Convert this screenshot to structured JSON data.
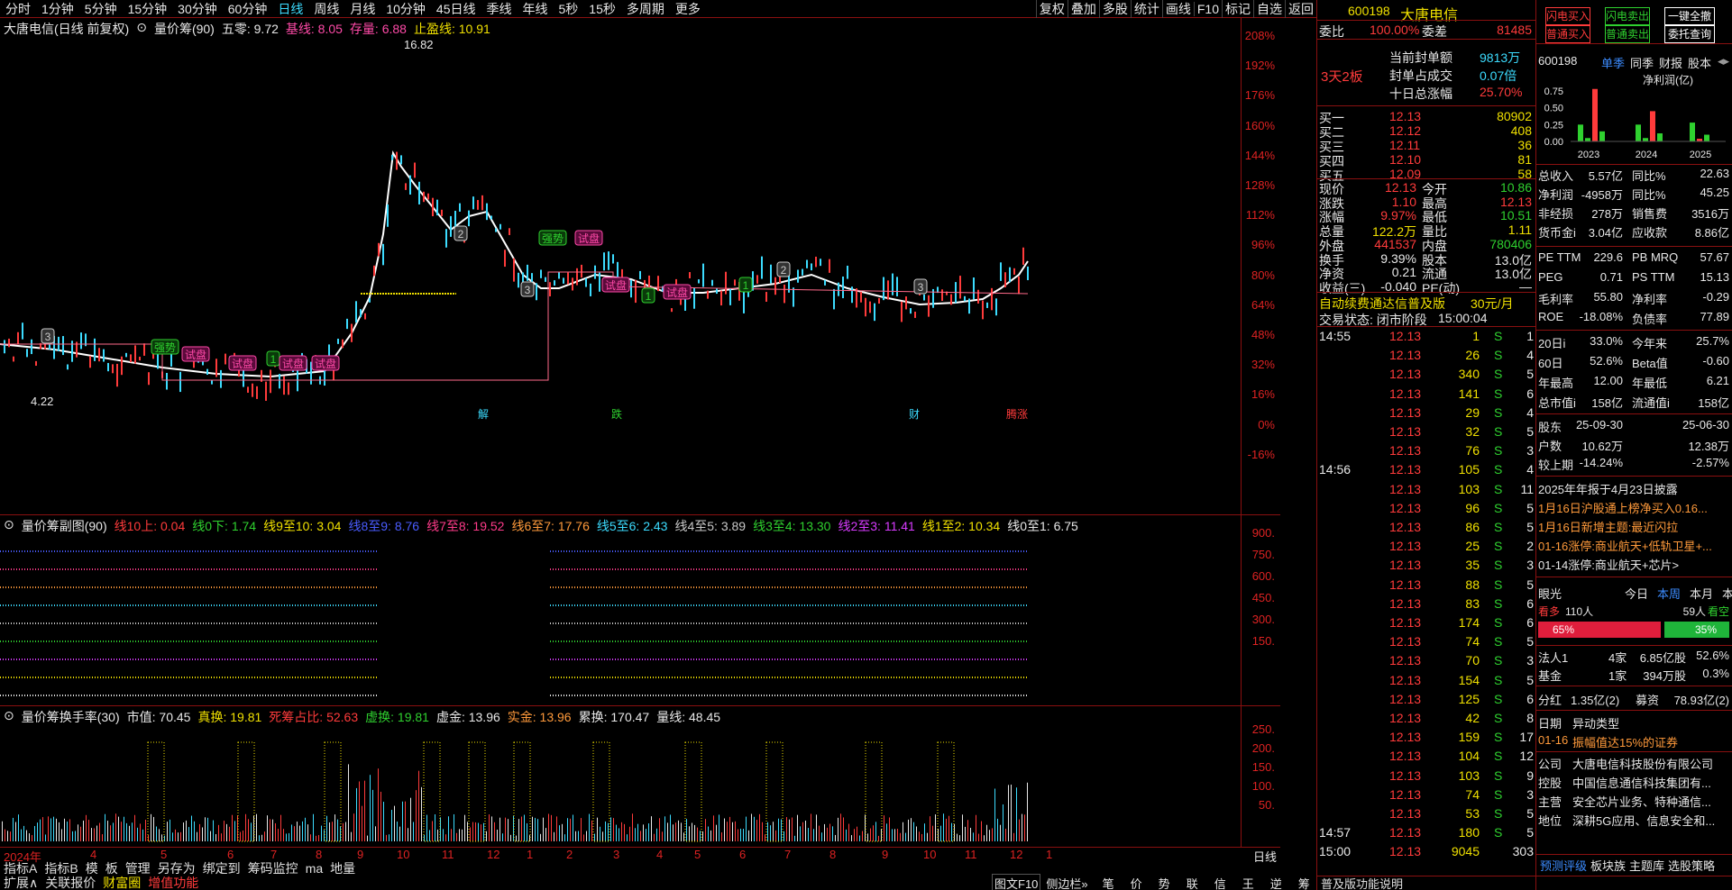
{
  "toolbar": {
    "periods": [
      "分时",
      "1分钟",
      "5分钟",
      "15分钟",
      "30分钟",
      "60分钟",
      "日线",
      "周线",
      "月线",
      "10分钟",
      "45日线",
      "季线",
      "年线",
      "5秒",
      "15秒",
      "多周期",
      "更多"
    ],
    "active_period": "日线",
    "tools": [
      "复权",
      "叠加",
      "多股",
      "统计",
      "画线",
      "F10",
      "标记",
      "自选",
      "返回"
    ]
  },
  "main_chart": {
    "title_parts": [
      {
        "text": "大唐电信(日线 前复权)",
        "color": "#e8e8e8"
      },
      {
        "text": "⊙",
        "color": "#e8e8e8"
      },
      {
        "text": "量价筹(90)",
        "color": "#e8e8e8"
      },
      {
        "text": "五零: 9.72",
        "color": "#e8e8e8"
      },
      {
        "text": "基线: 8.05",
        "color": "#ff4aa8"
      },
      {
        "text": "存量: 6.88",
        "color": "#ff4aa8"
      },
      {
        "text": "止盈线: 10.91",
        "color": "#f0e000"
      }
    ],
    "y_ticks": [
      "208%",
      "192%",
      "176%",
      "160%",
      "144%",
      "128%",
      "112%",
      "96%",
      "80%",
      "64%",
      "48%",
      "32%",
      "16%",
      "0%",
      "-16%"
    ],
    "high_label": "16.82",
    "low_label": "4.22",
    "tags": [
      {
        "text": "强势",
        "type": "green"
      },
      {
        "text": "试盘",
        "type": "pink"
      },
      {
        "text": "试盘",
        "type": "pink"
      },
      {
        "text": "1",
        "type": "green"
      },
      {
        "text": "试盘",
        "type": "pink"
      },
      {
        "text": "试盘",
        "type": "pink"
      },
      {
        "text": "2",
        "type": "gray"
      },
      {
        "text": "3",
        "type": "gray"
      },
      {
        "text": "强势",
        "type": "green"
      },
      {
        "text": "试盘",
        "type": "pink"
      },
      {
        "text": "试盘",
        "type": "pink"
      },
      {
        "text": "1",
        "type": "green"
      },
      {
        "text": "试盘",
        "type": "pink"
      },
      {
        "text": "1",
        "type": "green"
      },
      {
        "text": "2",
        "type": "gray"
      },
      {
        "text": "3",
        "type": "gray"
      },
      {
        "text": "3",
        "type": "gray"
      }
    ],
    "markers": [
      "解",
      "跌",
      "财",
      "腾涨"
    ]
  },
  "sub_chart1": {
    "title_parts": [
      {
        "text": "⊙",
        "color": "#e8e8e8"
      },
      {
        "text": "量价筹副图(90)",
        "color": "#e8e8e8"
      },
      {
        "text": "线10上: 0.04",
        "color": "#ff3b3b"
      },
      {
        "text": "线0下: 1.74",
        "color": "#2fd12f"
      },
      {
        "text": "线9至10: 3.04",
        "color": "#f0e000"
      },
      {
        "text": "线8至9: 8.76",
        "color": "#4a5cff"
      },
      {
        "text": "线7至8: 19.52",
        "color": "#ff3b8a"
      },
      {
        "text": "线6至7: 17.76",
        "color": "#ff9a3b"
      },
      {
        "text": "线5至6: 2.43",
        "color": "#3cdcff"
      },
      {
        "text": "线4至5: 3.89",
        "color": "#c8c8c8"
      },
      {
        "text": "线3至4: 13.30",
        "color": "#2fd12f"
      },
      {
        "text": "线2至3: 11.41",
        "color": "#d83bff"
      },
      {
        "text": "线1至2: 10.34",
        "color": "#f0e000"
      },
      {
        "text": "线0至1: 6.75",
        "color": "#e8e8e8"
      }
    ],
    "y_ticks": [
      "900.",
      "750.",
      "600.",
      "450.",
      "300.",
      "150."
    ]
  },
  "sub_chart2": {
    "title_parts": [
      {
        "text": "⊙",
        "color": "#e8e8e8"
      },
      {
        "text": "量价筹换手率(30)",
        "color": "#e8e8e8"
      },
      {
        "text": "市值: 70.45",
        "color": "#e8e8e8"
      },
      {
        "text": "真换: 19.81",
        "color": "#f0e000"
      },
      {
        "text": "死筹占比: 52.63",
        "color": "#ff3b3b"
      },
      {
        "text": "虚换: 19.81",
        "color": "#2fd12f"
      },
      {
        "text": "虚金: 13.96",
        "color": "#e8e8e8"
      },
      {
        "text": "实金: 13.96",
        "color": "#ff9a3b"
      },
      {
        "text": "累换: 170.47",
        "color": "#e8e8e8"
      },
      {
        "text": "量线: 48.45",
        "color": "#e8e8e8"
      }
    ],
    "y_ticks": [
      "250.",
      "200.",
      "150.",
      "100.",
      "50."
    ]
  },
  "dates": [
    "2024年",
    "4",
    "5",
    "6",
    "7",
    "8",
    "9",
    "10",
    "11",
    "12",
    "1",
    "2",
    "3",
    "4",
    "5",
    "6",
    "7",
    "8",
    "9",
    "10",
    "11",
    "12",
    "1"
  ],
  "date_axis_right": "日线",
  "bottom_tabs1": [
    "指标A",
    "指标B",
    "模",
    "板",
    "管理",
    "另存为",
    "绑定到",
    "筹码监控",
    "ma",
    "地量"
  ],
  "bottom_tabs2": [
    "扩展∧",
    "关联报价",
    "财富圈",
    "增值功能"
  ],
  "status_bar": {
    "text": "普及版功能说明",
    "tab1": "图文F10",
    "tab2": "侧边栏»",
    "icons": [
      "笔",
      "价",
      "势",
      "联",
      "信",
      "王",
      "逆",
      "筹"
    ]
  },
  "quote": {
    "code": "600198",
    "name": "大唐电信",
    "weibi_label": "委比",
    "weibi": "100.00%",
    "weicha_label": "委差",
    "weicha": "81485",
    "board": "3天2板",
    "seal_amount_label": "当前封单额",
    "seal_amount": "9813万",
    "seal_ratio_label": "封单占成交",
    "seal_ratio": "0.07倍",
    "ten_day_label": "十日总涨幅",
    "ten_day": "25.70%",
    "bids": [
      {
        "label": "买一",
        "price": "12.13",
        "vol": "80902"
      },
      {
        "label": "买二",
        "price": "12.12",
        "vol": "408"
      },
      {
        "label": "买三",
        "price": "12.11",
        "vol": "36"
      },
      {
        "label": "买四",
        "price": "12.10",
        "vol": "81"
      },
      {
        "label": "买五",
        "price": "12.09",
        "vol": "58"
      }
    ],
    "stats": [
      {
        "l1": "现价",
        "v1": "12.13",
        "l2": "今开",
        "v2": "10.86",
        "c1": "red",
        "c2": "green"
      },
      {
        "l1": "涨跌",
        "v1": "1.10",
        "l2": "最高",
        "v2": "12.13",
        "c1": "red",
        "c2": "red"
      },
      {
        "l1": "涨幅",
        "v1": "9.97%",
        "l2": "最低",
        "v2": "10.51",
        "c1": "red",
        "c2": "green"
      },
      {
        "l1": "总量",
        "v1": "122.2万",
        "l2": "量比",
        "v2": "1.11",
        "c1": "yellow",
        "c2": "yellow"
      },
      {
        "l1": "外盘",
        "v1": "441537",
        "l2": "内盘",
        "v2": "780406",
        "c1": "red",
        "c2": "green"
      },
      {
        "l1": "换手",
        "v1": "9.39%",
        "l2": "股本",
        "v2": "13.0亿",
        "c1": "white",
        "c2": "white"
      },
      {
        "l1": "净资",
        "v1": "0.21",
        "l2": "流通",
        "v2": "13.0亿",
        "c1": "white",
        "c2": "white"
      },
      {
        "l1": "收益(三)",
        "v1": "-0.040",
        "l2": "PE(动)",
        "v2": "—",
        "c1": "white",
        "c2": "white"
      }
    ],
    "promo": "自动续费通达信普及版",
    "promo_price": "30元/月",
    "trade_state": "交易状态: 闭市阶段",
    "trade_time": "15:00:04",
    "ticks": [
      {
        "time": "14:55",
        "price": "12.13",
        "vol": "1",
        "bs": "S",
        "n": "1"
      },
      {
        "time": "",
        "price": "12.13",
        "vol": "26",
        "bs": "S",
        "n": "4"
      },
      {
        "time": "",
        "price": "12.13",
        "vol": "340",
        "bs": "S",
        "n": "5"
      },
      {
        "time": "",
        "price": "12.13",
        "vol": "141",
        "bs": "S",
        "n": "6"
      },
      {
        "time": "",
        "price": "12.13",
        "vol": "29",
        "bs": "S",
        "n": "4"
      },
      {
        "time": "",
        "price": "12.13",
        "vol": "32",
        "bs": "S",
        "n": "5"
      },
      {
        "time": "",
        "price": "12.13",
        "vol": "76",
        "bs": "S",
        "n": "3"
      },
      {
        "time": "14:56",
        "price": "12.13",
        "vol": "105",
        "bs": "S",
        "n": "4"
      },
      {
        "time": "",
        "price": "12.13",
        "vol": "103",
        "bs": "S",
        "n": "11"
      },
      {
        "time": "",
        "price": "12.13",
        "vol": "96",
        "bs": "S",
        "n": "5"
      },
      {
        "time": "",
        "price": "12.13",
        "vol": "86",
        "bs": "S",
        "n": "5"
      },
      {
        "time": "",
        "price": "12.13",
        "vol": "25",
        "bs": "S",
        "n": "2"
      },
      {
        "time": "",
        "price": "12.13",
        "vol": "35",
        "bs": "S",
        "n": "3"
      },
      {
        "time": "",
        "price": "12.13",
        "vol": "88",
        "bs": "S",
        "n": "5"
      },
      {
        "time": "",
        "price": "12.13",
        "vol": "83",
        "bs": "S",
        "n": "6"
      },
      {
        "time": "",
        "price": "12.13",
        "vol": "174",
        "bs": "S",
        "n": "6"
      },
      {
        "time": "",
        "price": "12.13",
        "vol": "74",
        "bs": "S",
        "n": "5"
      },
      {
        "time": "",
        "price": "12.13",
        "vol": "70",
        "bs": "S",
        "n": "3"
      },
      {
        "time": "",
        "price": "12.13",
        "vol": "154",
        "bs": "S",
        "n": "5"
      },
      {
        "time": "",
        "price": "12.13",
        "vol": "125",
        "bs": "S",
        "n": "6"
      },
      {
        "time": "",
        "price": "12.13",
        "vol": "42",
        "bs": "S",
        "n": "8"
      },
      {
        "time": "",
        "price": "12.13",
        "vol": "159",
        "bs": "S",
        "n": "17"
      },
      {
        "time": "",
        "price": "12.13",
        "vol": "104",
        "bs": "S",
        "n": "12"
      },
      {
        "time": "",
        "price": "12.13",
        "vol": "103",
        "bs": "S",
        "n": "9"
      },
      {
        "time": "",
        "price": "12.13",
        "vol": "74",
        "bs": "S",
        "n": "3"
      },
      {
        "time": "",
        "price": "12.13",
        "vol": "53",
        "bs": "S",
        "n": "5"
      },
      {
        "time": "14:57",
        "price": "12.13",
        "vol": "180",
        "bs": "S",
        "n": "5"
      },
      {
        "time": "15:00",
        "price": "12.13",
        "vol": "9045",
        "bs": "",
        "n": "303"
      }
    ]
  },
  "f10": {
    "buttons": [
      {
        "text": "闪电买入",
        "type": "red"
      },
      {
        "text": "闪电卖出",
        "type": "green"
      },
      {
        "text": "一键全撤",
        "type": "white"
      },
      {
        "text": "普通买入",
        "type": "red"
      },
      {
        "text": "普通卖出",
        "type": "green"
      },
      {
        "text": "委托查询",
        "type": "white"
      }
    ],
    "code": "600198",
    "tabs": [
      "单季",
      "同季",
      "财报",
      "股本"
    ],
    "active_tab": "单季",
    "profit_label": "净利润(亿)",
    "chart_data": {
      "type": "bar",
      "categories": [
        "2023",
        "2024",
        "2025"
      ],
      "y_ticks": [
        "0.75",
        "0.50",
        "0.25",
        "0.00"
      ],
      "ylim": [
        0,
        0.75
      ],
      "series": [
        {
          "group": "2023",
          "values": [
            0.25,
            0.05,
            0.78,
            0.15
          ],
          "colors": [
            "#2fd12f",
            "#2fd12f",
            "#ff3b3b",
            "#2fd12f"
          ]
        },
        {
          "group": "2024",
          "values": [
            0.25,
            0.05,
            0.45,
            0.12
          ],
          "colors": [
            "#2fd12f",
            "#2fd12f",
            "#ff3b3b",
            "#2fd12f"
          ]
        },
        {
          "group": "2025",
          "values": [
            0.28,
            0.04,
            0.1
          ],
          "colors": [
            "#2fd12f",
            "#ff3b3b",
            "#2fd12f"
          ]
        }
      ]
    },
    "fin": [
      {
        "l1": "总收入",
        "v1": "5.57亿",
        "l2": "同比%",
        "v2": "22.63",
        "c2": "white"
      },
      {
        "l1": "净利润",
        "v1": "-4958万",
        "l2": "同比%",
        "v2": "45.25",
        "c2": "white"
      },
      {
        "l1": "非经损",
        "v1": "278万",
        "l2": "销售费",
        "v2": "3516万",
        "c2": "white"
      },
      {
        "l1": "货币金i",
        "v1": "3.04亿",
        "l2": "应收款",
        "v2": "8.86亿",
        "c2": "white"
      }
    ],
    "val": [
      {
        "l1": "PE TTM",
        "v1": "229.6",
        "l2": "PB MRQ",
        "v2": "57.67"
      },
      {
        "l1": "PEG",
        "v1": "0.71",
        "l2": "PS TTM",
        "v2": "15.13"
      },
      {
        "l1": "毛利率",
        "v1": "55.80",
        "l2": "净利率",
        "v2": "-0.29"
      },
      {
        "l1": "ROE",
        "v1": "-18.08%",
        "l2": "负债率",
        "v2": "77.89"
      }
    ],
    "perf": [
      {
        "l1": "20日i",
        "v1": "33.0%",
        "l2": "今年来",
        "v2": "25.7%"
      },
      {
        "l1": "60日",
        "v1": "52.6%",
        "l2": "Beta值",
        "v2": "-0.60"
      },
      {
        "l1": "年最高",
        "v1": "12.00",
        "l2": "年最低",
        "v2": "6.21"
      },
      {
        "l1": "总市值i",
        "v1": "158亿",
        "l2": "流通值i",
        "v2": "158亿"
      }
    ],
    "holders": [
      {
        "l1": "股东",
        "v1": "25-09-30",
        "v2": "25-06-30"
      },
      {
        "l1": "户数",
        "v1": "10.62万",
        "v2": "12.38万"
      },
      {
        "l1": "较上期",
        "v1": "-14.24%",
        "v2": "-2.57%"
      }
    ],
    "news": [
      {
        "text": "2025年年报于4月23日披露",
        "color": "#e8e8e8"
      },
      {
        "text": "1月16日沪股通上榜净买入0.16...",
        "color": "#ff9a3b"
      },
      {
        "text": "1月16日新增主题:最近闪拉",
        "color": "#ff9a3b"
      },
      {
        "text": "01-16涨停:商业航天+低轨卫星+...",
        "color": "#ff9a3b"
      },
      {
        "text": "01-14涨停:商业航天+芯片>",
        "color": "#e8e8e8"
      }
    ],
    "eye_label": "眼光",
    "eye_tabs": [
      "今日",
      "本周",
      "本月",
      "本年"
    ],
    "eye_active": "本周",
    "bull_label": "看多",
    "bull_count": "110人",
    "bear_label": "看空",
    "bear_count": "59人",
    "bull_pct": "65%",
    "bear_pct": "35%",
    "bull_ratio": 0.65,
    "inst": [
      {
        "l1": "法人1",
        "v1": "4家",
        "v2": "6.85亿股",
        "v3": "52.6%"
      },
      {
        "l1": "基金",
        "v1": "1家",
        "v2": "394万股",
        "v3": "0.3%"
      }
    ],
    "divide": {
      "l1": "分红",
      "v1": "1.35亿(2)",
      "l2": "募资",
      "v2": "78.93亿(2)"
    },
    "abn_head": {
      "l1": "日期",
      "v1": "异动类型"
    },
    "abn_row": {
      "l1": "01-16",
      "v1": "振幅值达15%的证券"
    },
    "company": [
      {
        "l1": "公司",
        "v1": "大唐电信科技股份有限公司"
      },
      {
        "l1": "控股",
        "v1": "中国信息通信科技集团有..."
      },
      {
        "l1": "主营",
        "v1": "安全芯片业务、特种通信..."
      },
      {
        "l1": "地位",
        "v1": "深耕5G应用、信息安全和..."
      }
    ],
    "bottom_links": [
      "预测评级",
      "板块族",
      "主题库",
      "选股策略"
    ]
  }
}
